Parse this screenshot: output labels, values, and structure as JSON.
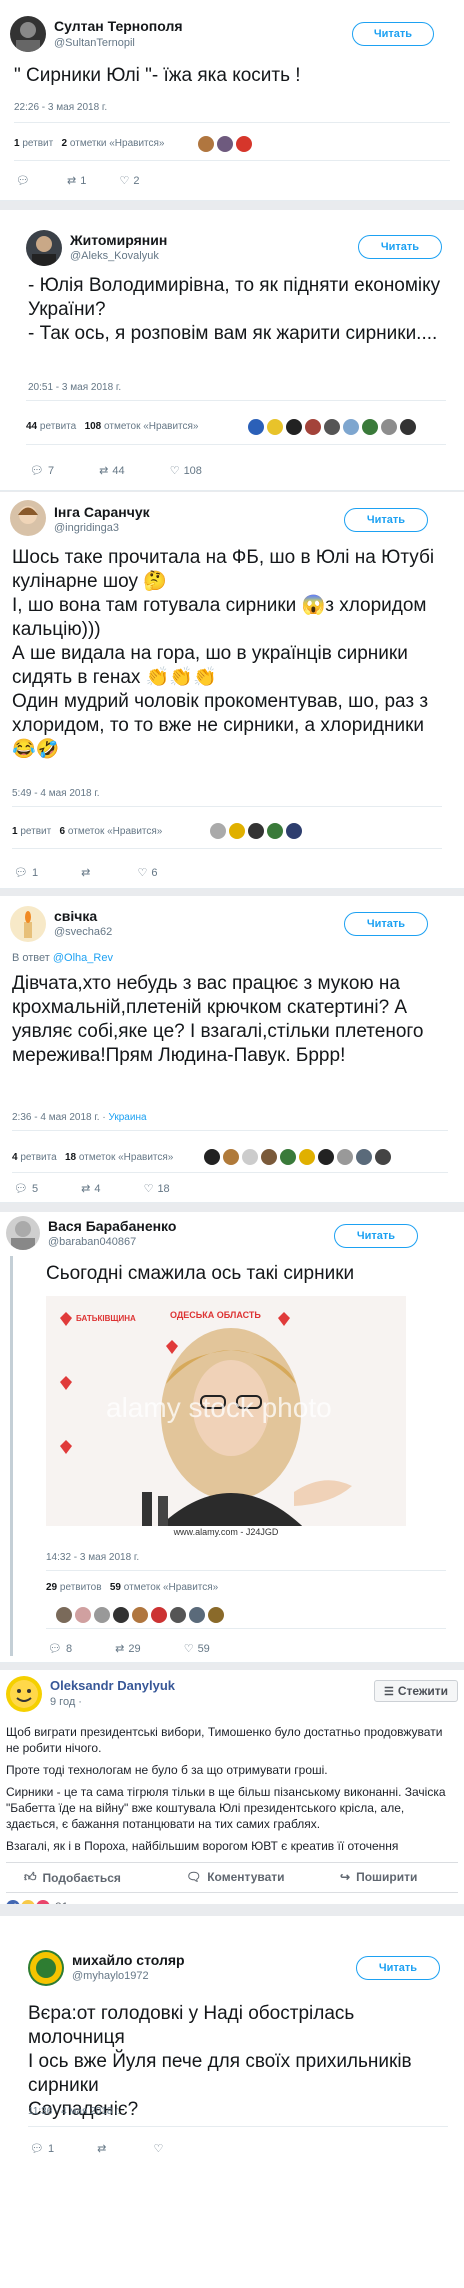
{
  "t1": {
    "name": "Султан Тернополя",
    "handle": "@SultanTernopil",
    "follow": "Читать",
    "text": "\" Сирники Юлі \"- їжа яка косить !",
    "time": "22:26 - 3 мая 2018 г.",
    "retweets": "1",
    "retweets_label": "ретвит",
    "likes": "2",
    "likes_label": "отметки «Нравится»",
    "reply_count": "",
    "rt_count": "1",
    "like_count": "2"
  },
  "t2": {
    "name": "Житомирянин",
    "handle": "@Aleks_Kovalyuk",
    "follow": "Читать",
    "text": "- Юлія Володимирівна, то як підняти економіку України?\n- Так ось, я розповім вам як жарити сирники....",
    "time": "20:51 - 3 мая 2018 г.",
    "retweets": "44",
    "retweets_label": "ретвита",
    "likes": "108",
    "likes_label": "отметок «Нравится»",
    "reply_count": "7",
    "rt_count": "44",
    "like_count": "108"
  },
  "t3": {
    "name": "Інга Саранчук",
    "handle": "@ingridinga3",
    "follow": "Читать",
    "text": "Шось таке прочитала на ФБ, шо в Юлі на Ютубі кулінарне шоу 🤔\nІ, шо вона там готувала сирники 😱з хлоридом кальцію)))\nА ше видала на гора, шо в українців сирники сидять в генах 👏👏👏\nОдин мудрий чоловік прокоментував, шо, раз з хлоридом, то то вже не сирники, а хлоридники 😂🤣",
    "time": "5:49 - 4 мая 2018 г.",
    "retweets": "1",
    "retweets_label": "ретвит",
    "likes": "6",
    "likes_label": "отметок «Нравится»",
    "reply_count": "1",
    "rt_count": "",
    "like_count": "6"
  },
  "t4": {
    "name": "свічка",
    "handle": "@svecha62",
    "follow": "Читать",
    "reply_prefix": "В ответ",
    "reply_user": "@Olha_Rev",
    "text": "Дівчата,хто небудь з вас працює з мукою на крохмальній,плетеній крючком скатертині? А уявляє собі,яке це? І взагалі,стільки плетеного мережива!Прям Людина-Павук. Бррр!",
    "time": "2:36 - 4 мая 2018 г. ·",
    "location": "Украина",
    "retweets": "4",
    "retweets_label": "ретвита",
    "likes": "18",
    "likes_label": "отметок «Нравится»",
    "reply_count": "5",
    "rt_count": "4",
    "like_count": "18"
  },
  "t5": {
    "name": "Вася Барабаненко",
    "handle": "@baraban040867",
    "follow": "Читать",
    "text": "Сьогодні смажила ось такі сирники",
    "photo_watermark": "alamy stock photo",
    "photo_banner": "ОДЕСЬКА ОБЛАСТЬ",
    "photo_party": "БАТЬКІВЩИНА",
    "photo_caption": "www.alamy.com - J24JGD",
    "time": "14:32 - 3 мая 2018 г.",
    "retweets": "29",
    "retweets_label": "ретвитов",
    "likes": "59",
    "likes_label": "отметок «Нравится»",
    "reply_count": "8",
    "rt_count": "29",
    "like_count": "59"
  },
  "fb": {
    "name": "Oleksandr Danylyuk",
    "time": "9 год ·",
    "follow": "Стежити",
    "p1": "Щоб виграти президентські вибори, Тимошенко було достатньо продовжувати не робити нічого.",
    "p2": "Проте тоді технологам не було б за що отримувати гроші.",
    "p3": "Сирники - це та сама тігрюля тільки в ще більш пізанському виконанні. Зачіска \"Бабетта їде на війну\" вже коштувала Юлі президентського крісла, але, здається, є бажання потанцювати на тих самих граблях.",
    "p4": "Взагалі, як і в Пороха, найбільшим ворогом ЮВТ є креатив її оточення",
    "like": "Подобається",
    "comment": "Коментувати",
    "share": "Поширити",
    "reactions": "81"
  },
  "t6": {
    "name": "михайло столяр",
    "handle": "@myhaylo1972",
    "follow": "Читать",
    "text": "Вєра:от голодовкі у Наді обострілась молочниця\nІ ось вже Йуля пече для своїх прихильників сирники\nСоупадєніє?",
    "time": "11:36 - 4 мая 2018 г.",
    "reply_count": "1",
    "rt_count": "",
    "like_count": ""
  },
  "colors": {
    "accent": "#1da1f2",
    "muted": "#657786",
    "fb_blue": "#4267b2"
  }
}
